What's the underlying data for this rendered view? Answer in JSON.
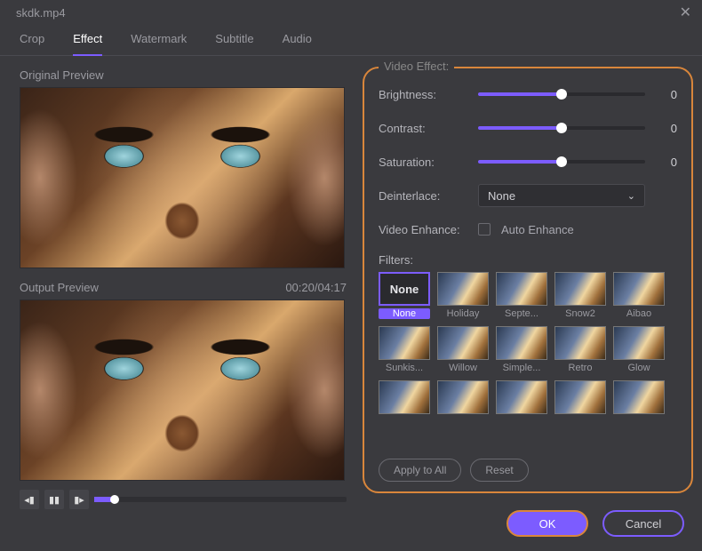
{
  "window": {
    "title": "skdk.mp4"
  },
  "tabs": {
    "crop": "Crop",
    "effect": "Effect",
    "watermark": "Watermark",
    "subtitle": "Subtitle",
    "audio": "Audio",
    "active": "effect"
  },
  "left": {
    "original_label": "Original Preview",
    "output_label": "Output Preview",
    "timecode": "00:20/04:17"
  },
  "effect": {
    "panel_title": "Video Effect:",
    "brightness": {
      "label": "Brightness:",
      "value": 0,
      "pct": 50
    },
    "contrast": {
      "label": "Contrast:",
      "value": 0,
      "pct": 50
    },
    "saturation": {
      "label": "Saturation:",
      "value": 0,
      "pct": 50
    },
    "deinterlace": {
      "label": "Deinterlace:",
      "selected": "None"
    },
    "enhance": {
      "label": "Video Enhance:",
      "check_label": "Auto Enhance",
      "checked": false
    },
    "filters_label": "Filters:",
    "filters": [
      {
        "name": "None",
        "selected": true
      },
      {
        "name": "Holiday",
        "selected": false
      },
      {
        "name": "Septe...",
        "selected": false
      },
      {
        "name": "Snow2",
        "selected": false
      },
      {
        "name": "Aibao",
        "selected": false
      },
      {
        "name": "Sunkis...",
        "selected": false
      },
      {
        "name": "Willow",
        "selected": false
      },
      {
        "name": "Simple...",
        "selected": false
      },
      {
        "name": "Retro",
        "selected": false
      },
      {
        "name": "Glow",
        "selected": false
      },
      {
        "name": "",
        "selected": false
      },
      {
        "name": "",
        "selected": false
      },
      {
        "name": "",
        "selected": false
      },
      {
        "name": "",
        "selected": false
      },
      {
        "name": "",
        "selected": false
      }
    ],
    "apply_all": "Apply to All",
    "reset": "Reset"
  },
  "footer": {
    "ok": "OK",
    "cancel": "Cancel"
  },
  "colors": {
    "accent": "#7c5cff",
    "highlight": "#d9863b"
  }
}
